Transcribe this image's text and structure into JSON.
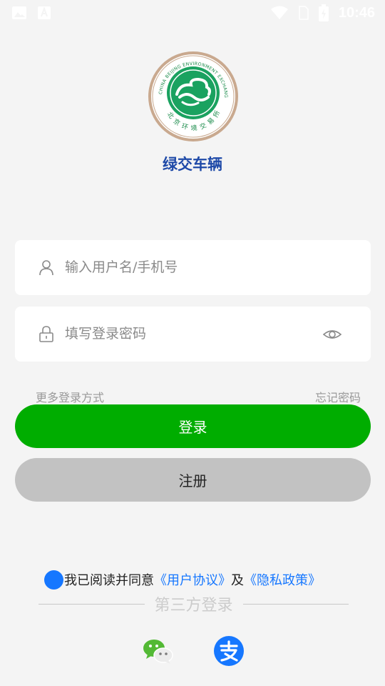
{
  "status_bar": {
    "time": "10:46",
    "icons": [
      "image-icon",
      "font-icon",
      "wifi-icon",
      "sim-icon",
      "battery-icon"
    ]
  },
  "logo": {
    "arc_text": "CHINA BEIJING ENVIRONMENT EXCHANGE",
    "bottom_text": "北京环境交易所"
  },
  "app_title": "绿交车辆",
  "login_form": {
    "username_placeholder": "输入用户名/手机号",
    "password_placeholder": "填写登录密码"
  },
  "links": {
    "more_login": "更多登录方式",
    "forgot_password": "忘记密码"
  },
  "buttons": {
    "login": "登录",
    "register": "注册"
  },
  "agreement": {
    "prefix": "我已阅读并同意",
    "user_agreement": "《用户协议》",
    "and": "及",
    "privacy_policy": "《隐私政策》"
  },
  "third_party": {
    "label": "第三方登录",
    "providers": [
      "wechat-icon",
      "alipay-icon"
    ]
  },
  "colors": {
    "primary_green": "#00ad00",
    "link_blue": "#1677ff",
    "title_blue": "#1f4aa8",
    "register_gray": "#c2c2c2",
    "background": "#f4f4f4"
  }
}
